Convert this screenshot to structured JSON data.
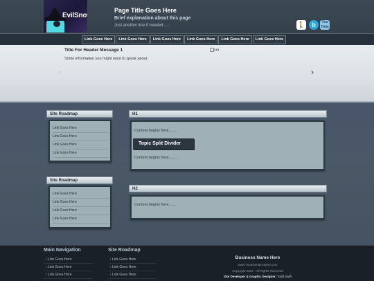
{
  "header": {
    "logo_text": "EvilSnow",
    "page_title": "Page Title Goes Here",
    "subtitle": "Brief explanation about this page",
    "tagline": "Just another line if needed......",
    "social_icons": [
      "person-icon",
      "b-icon",
      "youtube-icon"
    ],
    "yt_label_top": "You",
    "yt_label_bottom": "Tube"
  },
  "nav": {
    "links": [
      "Link Goes Here",
      "Link Goes Here",
      "Link Goes Here",
      "Link Goes Here",
      "Link Goes Here",
      "Link Goes Here"
    ]
  },
  "slider": {
    "title": "Title For Header Message 1",
    "info": "Some information you might want to speak about.",
    "image_alt": "xxx",
    "prev_arrow": "‹",
    "next_arrow": "›"
  },
  "sidebar": {
    "box1": {
      "title": "Site Roadmap",
      "items": [
        "Link Goes Here",
        "Link Goes Here",
        "Link Goes Here",
        "Link Goes Here"
      ]
    },
    "box2": {
      "title": "Site Roadmap",
      "items": [
        "Link Goes Here",
        "Link Goes Here",
        "Link Goes Here",
        "Link Goes Here"
      ]
    }
  },
  "content": {
    "h1": {
      "title": "H1",
      "text1": "Content begins here........",
      "divider": "Topic Split Divider",
      "text2": "Content begins here........"
    },
    "h2": {
      "title": "H2",
      "text1": "Content begins here........"
    }
  },
  "footer": {
    "main_nav": {
      "title": "Main Navigation",
      "items": [
        "Link Goes Here",
        "Link Goes Here",
        "Link Goes Here"
      ]
    },
    "roadmap": {
      "title": "Site Roadmap",
      "items": [
        "Link Goes Here",
        "Link Goes Here",
        "Link Goes Here"
      ]
    },
    "business_name": "Business Name Here",
    "url": "www.YourDomainName.com",
    "copyright": "Copyright 2022 - All Rights Reserved",
    "dev_label": "Site Developer & Graphic Designer:",
    "dev_name": "Todd Swift"
  },
  "colors": {
    "header_bg": "#3d4a55",
    "main_bg": "#4a5866",
    "box_bg": "#9fb0b7",
    "footer_bg": "#1a2027"
  }
}
